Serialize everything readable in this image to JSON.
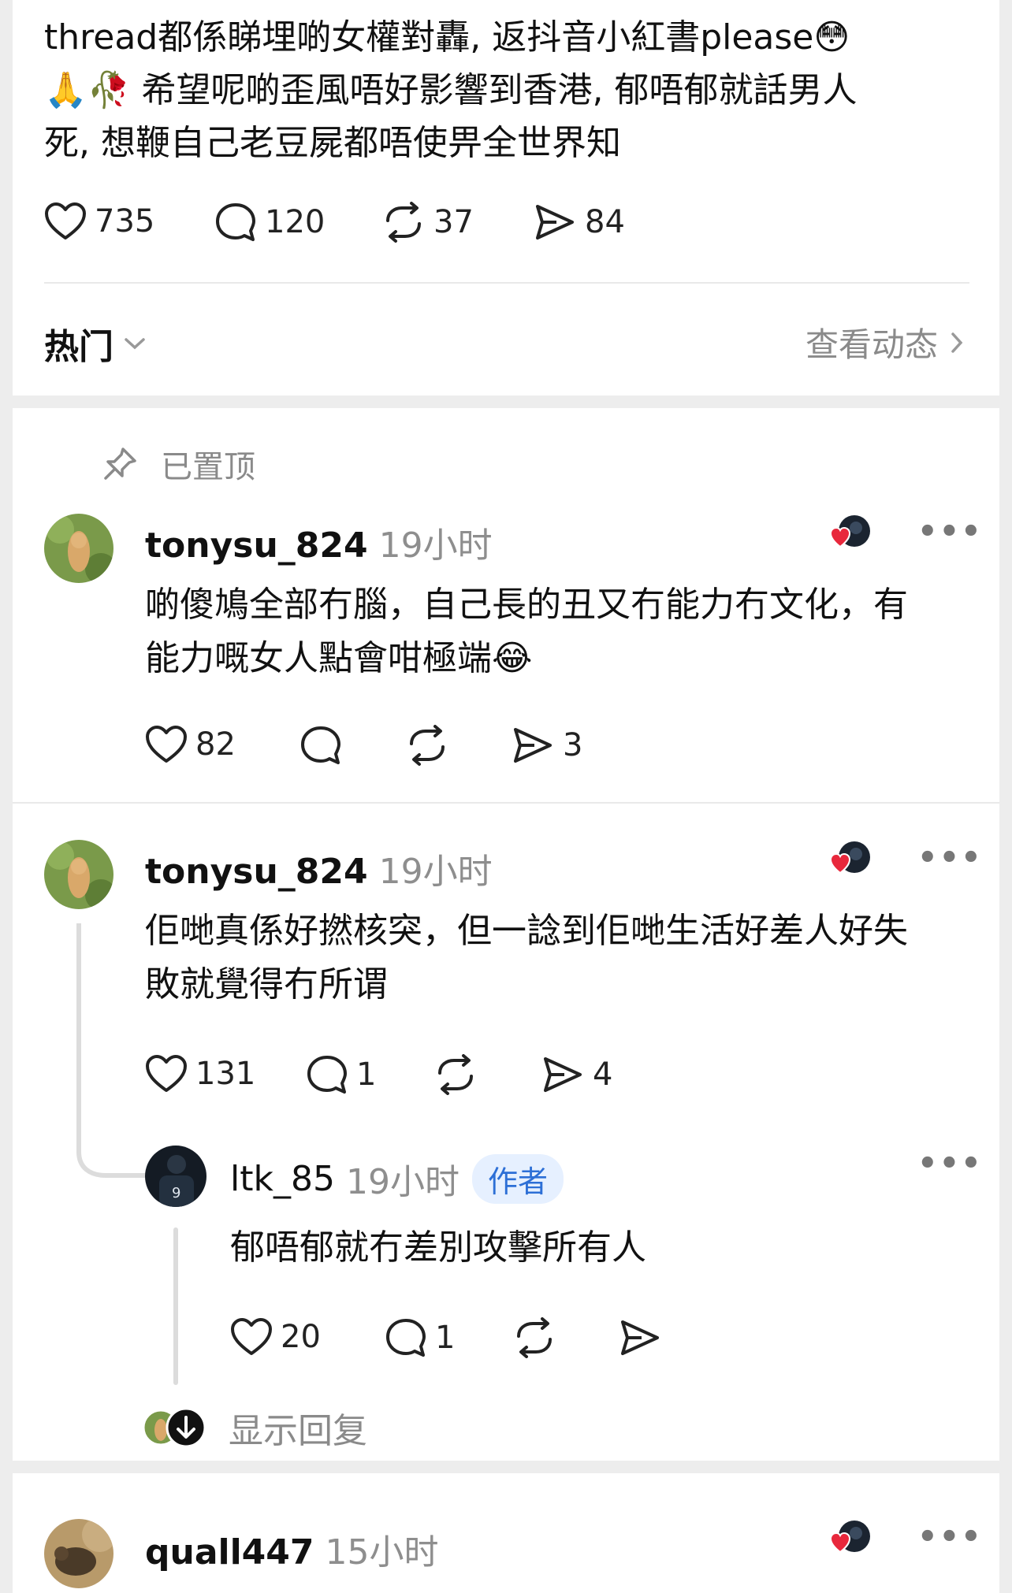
{
  "post": {
    "text": "thread都係睇埋啲女權對轟, 返抖音小紅書please😳\n🙏🥀 希望呢啲歪風唔好影響到香港, 郁唔郁就話男人\n死, 想鞭自己老豆屍都唔使畀全世界知",
    "likes": "735",
    "comments": "120",
    "reposts": "37",
    "shares": "84"
  },
  "tabs": {
    "sort_label": "热门",
    "view_activity": "查看动态"
  },
  "pinned_label": "已置顶",
  "comments": [
    {
      "username": "tonysu_824",
      "time": "19小时",
      "text": "啲傻鳩全部冇腦，自己長的丑又冇能力冇文化，有\n能力嘅女人點會咁極端😂",
      "likes": "82",
      "replies": "",
      "shares": "3"
    },
    {
      "username": "tonysu_824",
      "time": "19小时",
      "text": "佢哋真係好撚核突，但一諗到佢哋生活好差人好失\n敗就覺得冇所谓",
      "likes": "131",
      "replies": "1",
      "shares": "4"
    },
    {
      "username": "ltk_85",
      "time": "19小时",
      "badge": "作者",
      "text": "郁唔郁就冇差別攻擊所有人",
      "likes": "20",
      "replies": "1",
      "shares": ""
    },
    {
      "username": "quall447",
      "time": "15小时"
    }
  ],
  "show_replies_label": "显示回复",
  "colors": {
    "background": "#ededed",
    "card": "#ffffff",
    "muted": "#8a8a8a",
    "author_badge_bg": "#e6f0ff",
    "author_badge_text": "#2d6fd6",
    "heart_red": "#e8283c"
  }
}
